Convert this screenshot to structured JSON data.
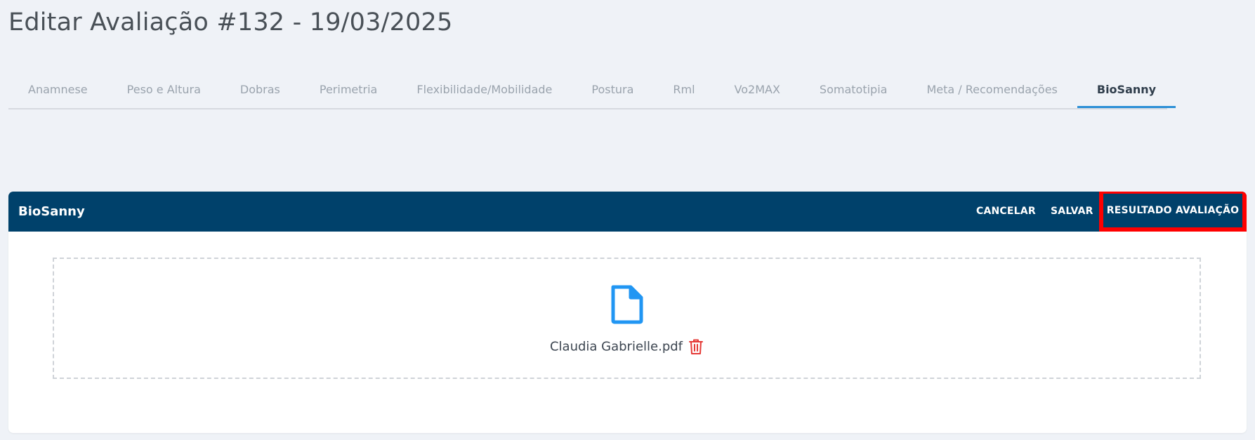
{
  "page": {
    "title": "Editar Avaliação #132 - 19/03/2025"
  },
  "tabs": [
    {
      "label": "Anamnese"
    },
    {
      "label": "Peso e Altura"
    },
    {
      "label": "Dobras"
    },
    {
      "label": "Perimetria"
    },
    {
      "label": "Flexibilidade/Mobilidade"
    },
    {
      "label": "Postura"
    },
    {
      "label": "Rml"
    },
    {
      "label": "Vo2MAX"
    },
    {
      "label": "Somatotipia"
    },
    {
      "label": "Meta / Recomendações"
    },
    {
      "label": "BioSanny",
      "active": true
    }
  ],
  "card": {
    "title": "BioSanny",
    "cancel_label": "CANCELAR",
    "save_label": "SALVAR",
    "result_label": "RESULTADO AVALIAÇÃO"
  },
  "upload": {
    "file_name": "Claudia Gabrielle.pdf",
    "file_icon": "file-icon",
    "delete_icon": "trash-icon"
  },
  "colors": {
    "header_bg": "#00416b",
    "active_tab_underline": "#2b8fd6",
    "file_icon": "#2196f3",
    "delete_icon": "#e53935",
    "highlight": "#ff0000"
  }
}
